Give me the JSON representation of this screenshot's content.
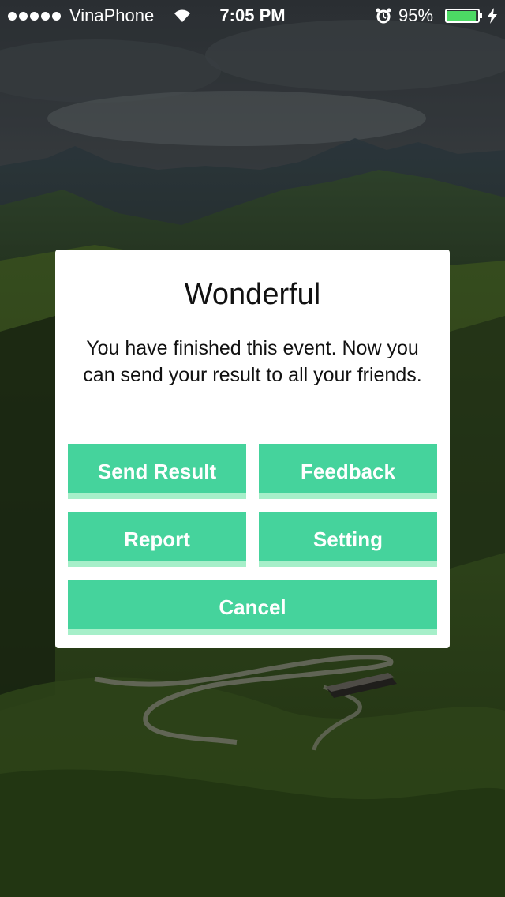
{
  "status_bar": {
    "carrier": "VinaPhone",
    "time": "7:05 PM",
    "battery_percent": "95%",
    "battery_level": 0.95,
    "icons": [
      "signal-dots",
      "wifi-icon",
      "alarm-icon",
      "battery-icon",
      "charging-bolt-icon"
    ]
  },
  "background": {
    "description_icon": "mountain-landscape-photo"
  },
  "dialog": {
    "title": "Wonderful",
    "message": "You have finished this event. Now you can send your result to all your friends.",
    "buttons": {
      "send_result": "Send Result",
      "feedback": "Feedback",
      "report": "Report",
      "setting": "Setting",
      "cancel": "Cancel"
    }
  },
  "colors": {
    "button": "#45d39c",
    "button_shadow": "#a6efc9",
    "dialog_bg": "#ffffff"
  }
}
